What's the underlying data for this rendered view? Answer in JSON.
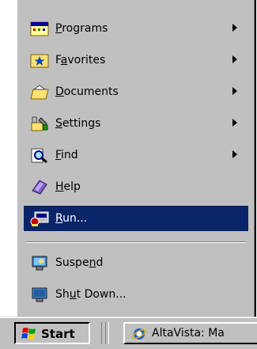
{
  "start_menu": {
    "items": [
      {
        "pre": "",
        "key": "P",
        "post": "rograms",
        "icon": "programs-icon",
        "submenu": true
      },
      {
        "pre": "F",
        "key": "a",
        "post": "vorites",
        "icon": "favorites-icon",
        "submenu": true
      },
      {
        "pre": "",
        "key": "D",
        "post": "ocuments",
        "icon": "documents-icon",
        "submenu": true
      },
      {
        "pre": "",
        "key": "S",
        "post": "ettings",
        "icon": "settings-icon",
        "submenu": true
      },
      {
        "pre": "",
        "key": "F",
        "post": "ind",
        "icon": "find-icon",
        "submenu": true
      },
      {
        "pre": "",
        "key": "H",
        "post": "elp",
        "icon": "help-icon",
        "submenu": false
      },
      {
        "pre": "",
        "key": "R",
        "post": "un...",
        "icon": "run-icon",
        "submenu": false
      },
      {
        "pre": "Suspe",
        "key": "n",
        "post": "d",
        "icon": "suspend-icon",
        "submenu": false
      },
      {
        "pre": "Sh",
        "key": "u",
        "post": "t Down...",
        "icon": "shutdown-icon",
        "submenu": false
      }
    ]
  },
  "taskbar": {
    "start_label": "Start",
    "task_label": "AltaVista: Ma"
  },
  "colors": {
    "face": "#c0c0c0",
    "selection": "#0a246a"
  }
}
